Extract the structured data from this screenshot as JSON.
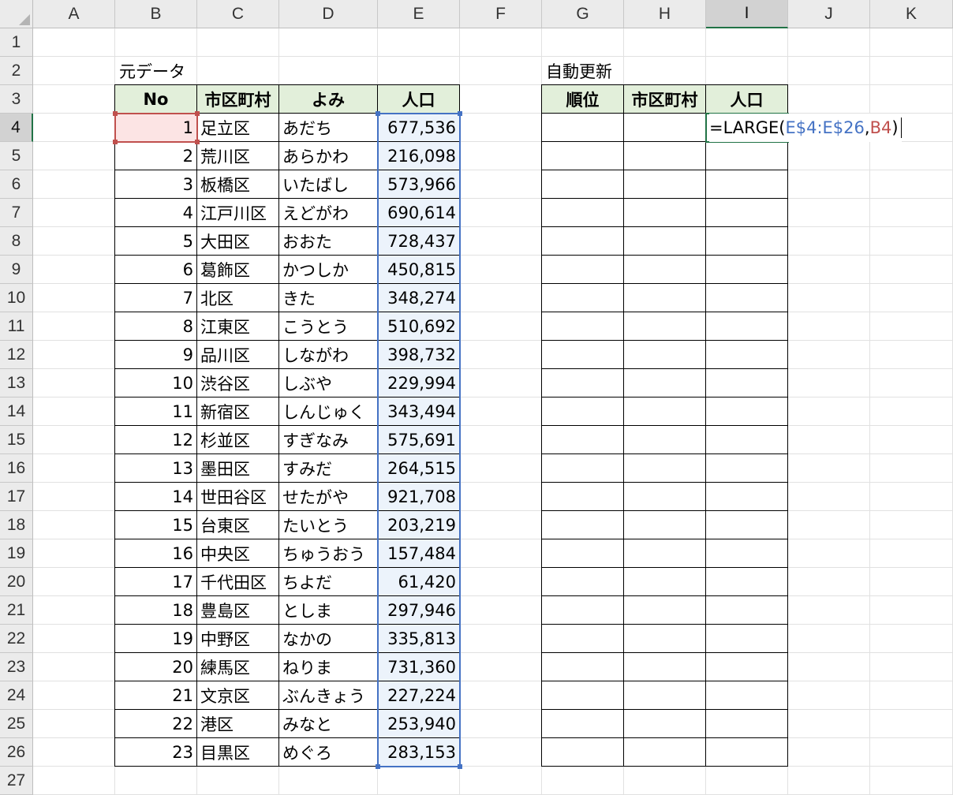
{
  "columns": [
    "A",
    "B",
    "C",
    "D",
    "E",
    "F",
    "G",
    "H",
    "I",
    "J",
    "K"
  ],
  "rows": [
    "1",
    "2",
    "3",
    "4",
    "5",
    "6",
    "7",
    "8",
    "9",
    "10",
    "11",
    "12",
    "13",
    "14",
    "15",
    "16",
    "17",
    "18",
    "19",
    "20",
    "21",
    "22",
    "23",
    "24",
    "25",
    "26",
    "27"
  ],
  "active_column": "I",
  "active_row": "4",
  "left_table": {
    "title": "元データ",
    "headers": [
      "No",
      "市区町村",
      "よみ",
      "人口"
    ],
    "rows": [
      [
        "1",
        "足立区",
        "あだち",
        "677,536"
      ],
      [
        "2",
        "荒川区",
        "あらかわ",
        "216,098"
      ],
      [
        "3",
        "板橋区",
        "いたばし",
        "573,966"
      ],
      [
        "4",
        "江戸川区",
        "えどがわ",
        "690,614"
      ],
      [
        "5",
        "大田区",
        "おおた",
        "728,437"
      ],
      [
        "6",
        "葛飾区",
        "かつしか",
        "450,815"
      ],
      [
        "7",
        "北区",
        "きた",
        "348,274"
      ],
      [
        "8",
        "江東区",
        "こうとう",
        "510,692"
      ],
      [
        "9",
        "品川区",
        "しながわ",
        "398,732"
      ],
      [
        "10",
        "渋谷区",
        "しぶや",
        "229,994"
      ],
      [
        "11",
        "新宿区",
        "しんじゅく",
        "343,494"
      ],
      [
        "12",
        "杉並区",
        "すぎなみ",
        "575,691"
      ],
      [
        "13",
        "墨田区",
        "すみだ",
        "264,515"
      ],
      [
        "14",
        "世田谷区",
        "せたがや",
        "921,708"
      ],
      [
        "15",
        "台東区",
        "たいとう",
        "203,219"
      ],
      [
        "16",
        "中央区",
        "ちゅうおう",
        "157,484"
      ],
      [
        "17",
        "千代田区",
        "ちよだ",
        "61,420"
      ],
      [
        "18",
        "豊島区",
        "としま",
        "297,946"
      ],
      [
        "19",
        "中野区",
        "なかの",
        "335,813"
      ],
      [
        "20",
        "練馬区",
        "ねりま",
        "731,360"
      ],
      [
        "21",
        "文京区",
        "ぶんきょう",
        "227,224"
      ],
      [
        "22",
        "港区",
        "みなと",
        "253,940"
      ],
      [
        "23",
        "目黒区",
        "めぐろ",
        "283,153"
      ]
    ]
  },
  "right_table": {
    "title": "自動更新",
    "headers": [
      "順位",
      "市区町村",
      "人口"
    ],
    "row_count": 23
  },
  "formula": {
    "prefix": "=LARGE(",
    "range_ref": "E$4:E$26",
    "comma": ",",
    "cell_ref": "B4",
    "suffix": ")"
  },
  "colors": {
    "header_fill": "#e2efda",
    "selection_fill": "#fce4e4",
    "range_fill": "#ecf3fb",
    "range_ref_color": "#4472c4",
    "cell_ref_color": "#c0504d",
    "active_accent": "#217346"
  }
}
